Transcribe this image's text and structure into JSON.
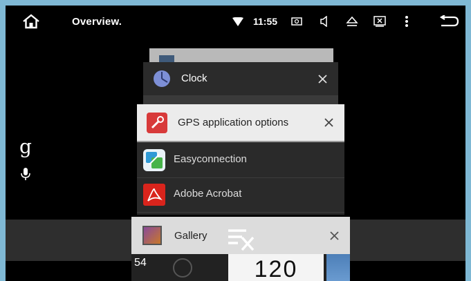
{
  "statusbar": {
    "title": "Overview.",
    "time": "11:55"
  },
  "cards": {
    "clock": {
      "label": "Clock"
    },
    "gps": {
      "label": "GPS application options"
    },
    "easyconnection": {
      "label": "Easyconnection"
    },
    "adobe": {
      "label": "Adobe Acrobat"
    },
    "gallery": {
      "label": "Gallery"
    }
  },
  "gallery_thumb": {
    "number": "54",
    "speed": "120"
  },
  "google": {
    "logo": "g"
  },
  "colors": {
    "background": "#7fb8d4",
    "screen": "#000000",
    "gps_icon": "#d83a3a",
    "adobe_red": "#d9241c"
  }
}
